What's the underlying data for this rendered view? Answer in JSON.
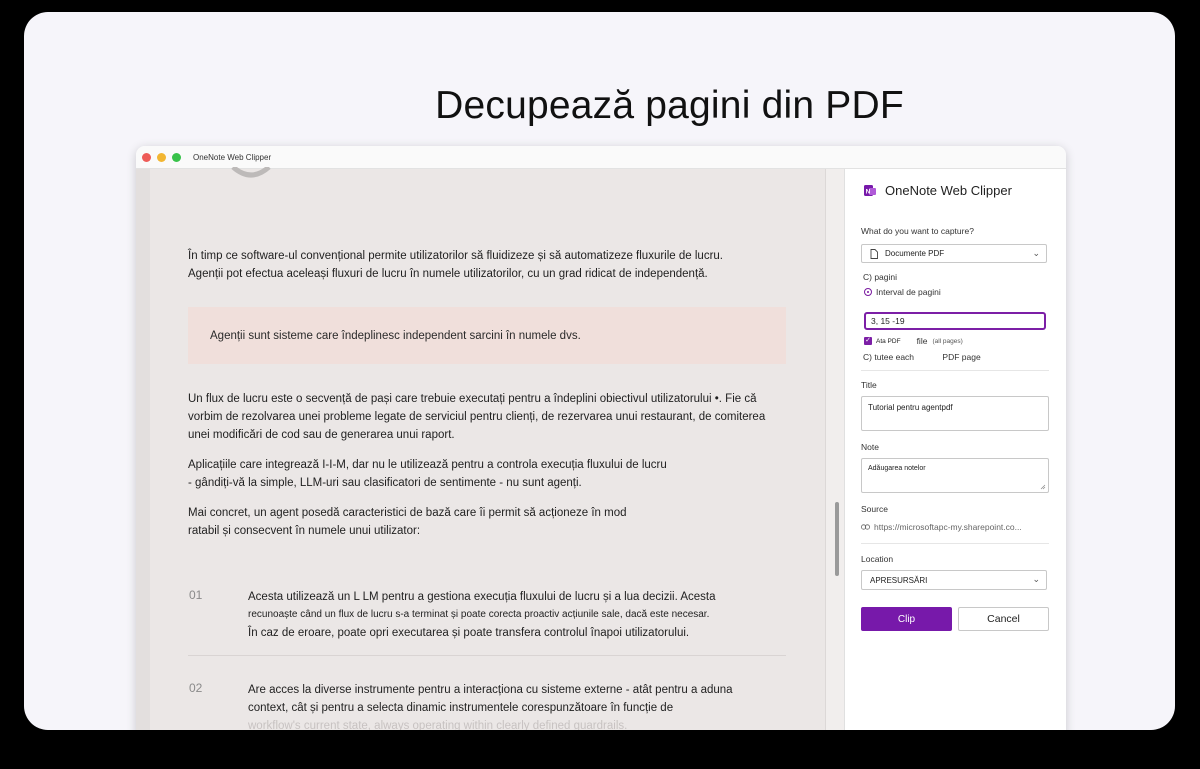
{
  "hero": {
    "title": "Decupează pagini din PDF"
  },
  "window": {
    "app_title": "OneNote Web Clipper"
  },
  "document": {
    "para1": "În timp ce software-ul convențional permite utilizatorilor să fluidizeze și să automatizeze fluxurile de lucru. Agenții pot efectua aceleași fluxuri de lucru în numele utilizatorilor, cu un grad ridicat de independență.",
    "callout": "Agenții sunt sisteme care îndeplinesc independent sarcini în numele dvs.",
    "para2": "Un flux de lucru este o secvență de pași care trebuie executați pentru a îndeplini obiectivul utilizatorului •. Fie că vorbim de rezolvarea unei probleme legate de serviciul pentru clienți, de rezervarea unui restaurant, de comiterea unei modificări de cod sau de generarea unui raport.",
    "para3": "Aplicațiile care integrează I-I-M, dar nu le utilizează pentru a controla execuția fluxului de lucru - gândiți-vă la simple, LLM-uri sau clasificatori de sentimente - nu sunt agenți.",
    "para4": "Mai concret, un agent posedă caracteristici de bază care îi permit să acționeze în mod ratabil și consecvent în numele unui utilizator:",
    "items": [
      {
        "num": "01",
        "line1": "Acesta utilizează un L LM pentru a gestiona execuția fluxului de lucru și a lua decizii. Acesta",
        "line2": "recunoaște când un flux de lucru s-a terminat și poate corecta proactiv acțiunile sale, dacă este necesar.",
        "line3": "În caz de eroare, poate opri executarea și poate transfera controlul înapoi utilizatorului."
      },
      {
        "num": "02",
        "line1": "Are acces la diverse instrumente pentru a interacționa cu sisteme externe - atât pentru a aduna",
        "line2": "context, cât și pentru a selecta dinamic instrumentele corespunzătoare în funcție de",
        "line3": "workflow's current state, always operating within clearly defined guardrails."
      }
    ]
  },
  "panel": {
    "title": "OneNote Web Clipper",
    "capture_label": "What do you want to capture?",
    "capture_value": "Documente PDF",
    "pages_label": "C) pagini",
    "range_label": "Interval de pagini",
    "range_value": "3, 15 -19",
    "attach_label": "Ata PDF",
    "attach_file": "file",
    "attach_hint": "(all pages)",
    "each_label": "C) tutee each",
    "each_suffix": "PDF page",
    "title_label": "Title",
    "title_value": "Tutorial pentru agentpdf",
    "note_label": "Note",
    "note_value": "Adăugarea notelor",
    "source_label": "Source",
    "source_value": "https://microsoftapc-my.sharepoint.co...",
    "location_label": "Location",
    "location_value": "APRESURSĂRI",
    "clip_button": "Clip",
    "cancel_button": "Cancel"
  },
  "colors": {
    "accent": "#7719aa",
    "callout_bg": "#f0dfdb",
    "doc_bg": "#ebe7e6"
  }
}
